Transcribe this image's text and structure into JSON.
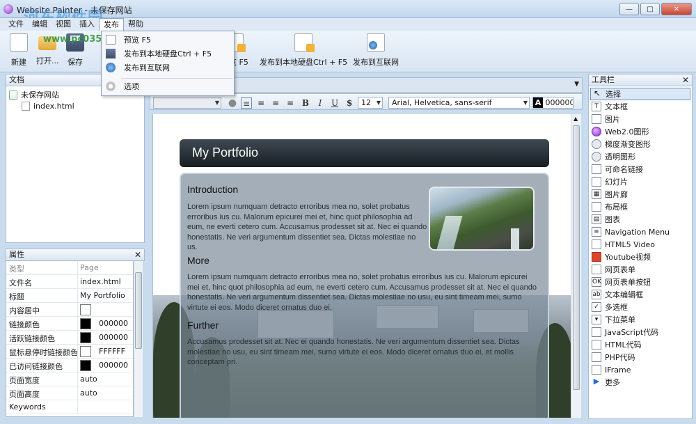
{
  "window": {
    "title": "Website Painter - 未保存网站",
    "watermark": "河东软件园",
    "watermark_url": "www.pc0359.cn"
  },
  "menu": [
    {
      "label": "文件"
    },
    {
      "label": "编辑"
    },
    {
      "label": "视图"
    },
    {
      "label": "插入"
    },
    {
      "label": "发布"
    },
    {
      "label": "帮助"
    }
  ],
  "toolbar": {
    "new": "新建",
    "open": "打开...",
    "save": "保存",
    "preview": "预览 F5",
    "publish_local": "发布到本地硬盘Ctrl + F5",
    "publish_web": "发布到互联网"
  },
  "publish_menu": {
    "items": [
      "预览 F5",
      "发布到本地硬盘Ctrl + F5",
      "发布到互联网"
    ],
    "options": "选项"
  },
  "documents": {
    "title": "文档",
    "site": "未保存网站",
    "file": "index.html"
  },
  "properties": {
    "title": "属性",
    "rows": [
      {
        "key": "类型",
        "value": "Page"
      },
      {
        "key": "文件名",
        "value": "index.html"
      },
      {
        "key": "标题",
        "value": "My Portfolio"
      },
      {
        "key": "内容居中",
        "value": ""
      },
      {
        "key": "链接颜色",
        "value": "000000",
        "color": "#000000"
      },
      {
        "key": "活跃链接颜色",
        "value": "000000",
        "color": "#000000"
      },
      {
        "key": "鼠标悬停时链接颜色",
        "value": "FFFFFF",
        "color": "#FFFFFF"
      },
      {
        "key": "已访问链接颜色",
        "value": "000000",
        "color": "#000000"
      },
      {
        "key": "页面宽度",
        "value": "auto"
      },
      {
        "key": "页面高度",
        "value": "auto"
      },
      {
        "key": "Keywords",
        "value": ""
      }
    ]
  },
  "format": {
    "font_size": "12",
    "font_family": "Arial, Helvetica, sans-serif",
    "color_label": "A",
    "color_value": "000000"
  },
  "page": {
    "header": "My Portfolio",
    "sections": [
      {
        "heading": "Introduction",
        "text": "Lorem ipsum numquam detracto erroribus mea no, solet probatus erroribus ius cu. Malorum epicurei mei et, hinc quot philosophia ad eum, ne everti cetero cum. Accusamus prodesset sit at. Nec ei quando honestatis. Ne veri argumentum dissentiet sea. Dictas molestiae no us."
      },
      {
        "heading": "More",
        "text": "Lorem ipsum numquam detracto erroribus mea no, solet probatus erroribus ius cu. Malorum epicurei mei et, hinc quot philosophia ad eum, ne everti cetero cum. Accusamus prodesset sit at. Nec ei quando honestatis. Ne veri argumentum dissentiet sea. Dictas molestiae no usu, eu sint timeam mei, sumo virtute ei eos. Modo diceret ornatus duo ei."
      },
      {
        "heading": "Further",
        "text": "Accusamus prodesset sit at. Nec ei quando honestatis. Ne veri argumentum dissentiet sea. Dictas molestiae no usu, eu sint timeam mei, sumo virtute ei eos. Modo diceret ornatus duo ei, et mollis conceptam pri."
      }
    ]
  },
  "toolbox": {
    "title": "工具栏",
    "items": [
      "选择",
      "文本框",
      "图片",
      "Web2.0图形",
      "梯度渐变图形",
      "透明图形",
      "可命名链接",
      "幻灯片",
      "图片廊",
      "布局框",
      "图表",
      "Navigation Menu",
      "HTML5 Video",
      "Youtube视频",
      "网页表单",
      "网页表单按钮",
      "文本编辑框",
      "多选框",
      "下拉菜单",
      "JavaScript代码",
      "HTML代码",
      "PHP代码",
      "IFrame",
      "更多"
    ]
  }
}
